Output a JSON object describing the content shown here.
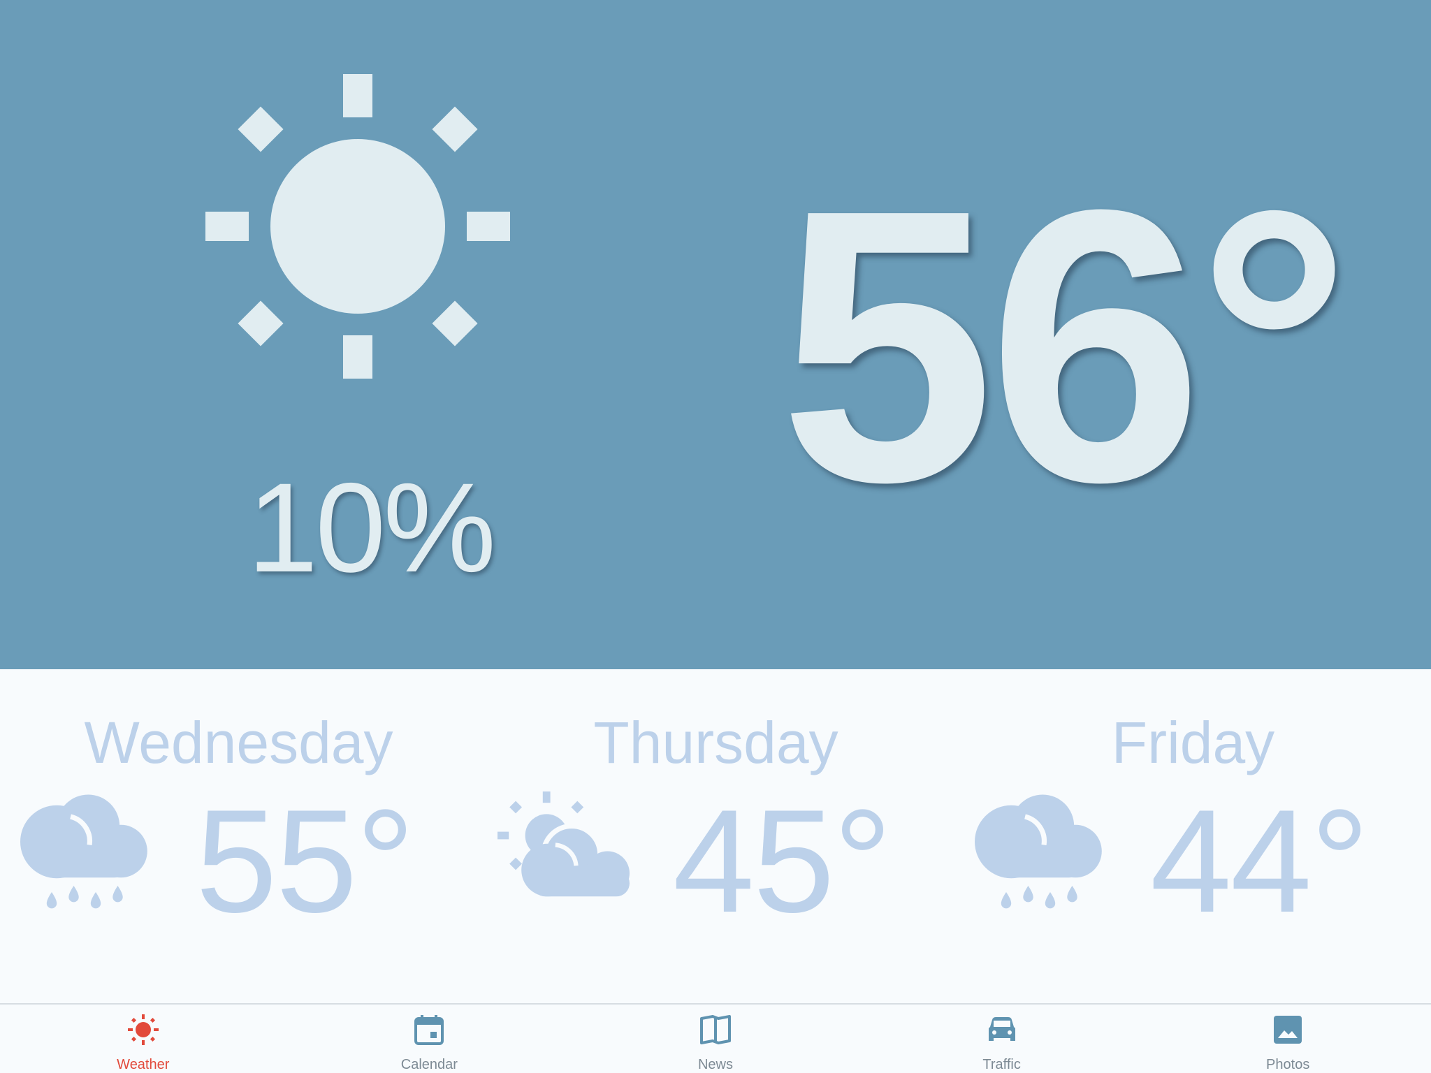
{
  "colors": {
    "hero_background": "#6a9cb8",
    "hero_foreground": "#e1edf1",
    "forecast_foreground": "#bcd1ea",
    "tab_active": "#e24a3b",
    "tab_inactive": "#7d8a94",
    "tab_icon": "#5f93b0"
  },
  "current": {
    "icon": "sun-icon",
    "precipitation": "10%",
    "temperature": "56°"
  },
  "forecast": [
    {
      "day": "Wednesday",
      "icon": "rain-icon",
      "temperature": "55°"
    },
    {
      "day": "Thursday",
      "icon": "partly-cloudy-icon",
      "temperature": "45°"
    },
    {
      "day": "Friday",
      "icon": "rain-icon",
      "temperature": "44°"
    }
  ],
  "tabs": [
    {
      "label": "Weather",
      "icon": "sun-icon",
      "active": true
    },
    {
      "label": "Calendar",
      "icon": "calendar-icon",
      "active": false
    },
    {
      "label": "News",
      "icon": "book-icon",
      "active": false
    },
    {
      "label": "Traffic",
      "icon": "car-icon",
      "active": false
    },
    {
      "label": "Photos",
      "icon": "photo-icon",
      "active": false
    }
  ]
}
